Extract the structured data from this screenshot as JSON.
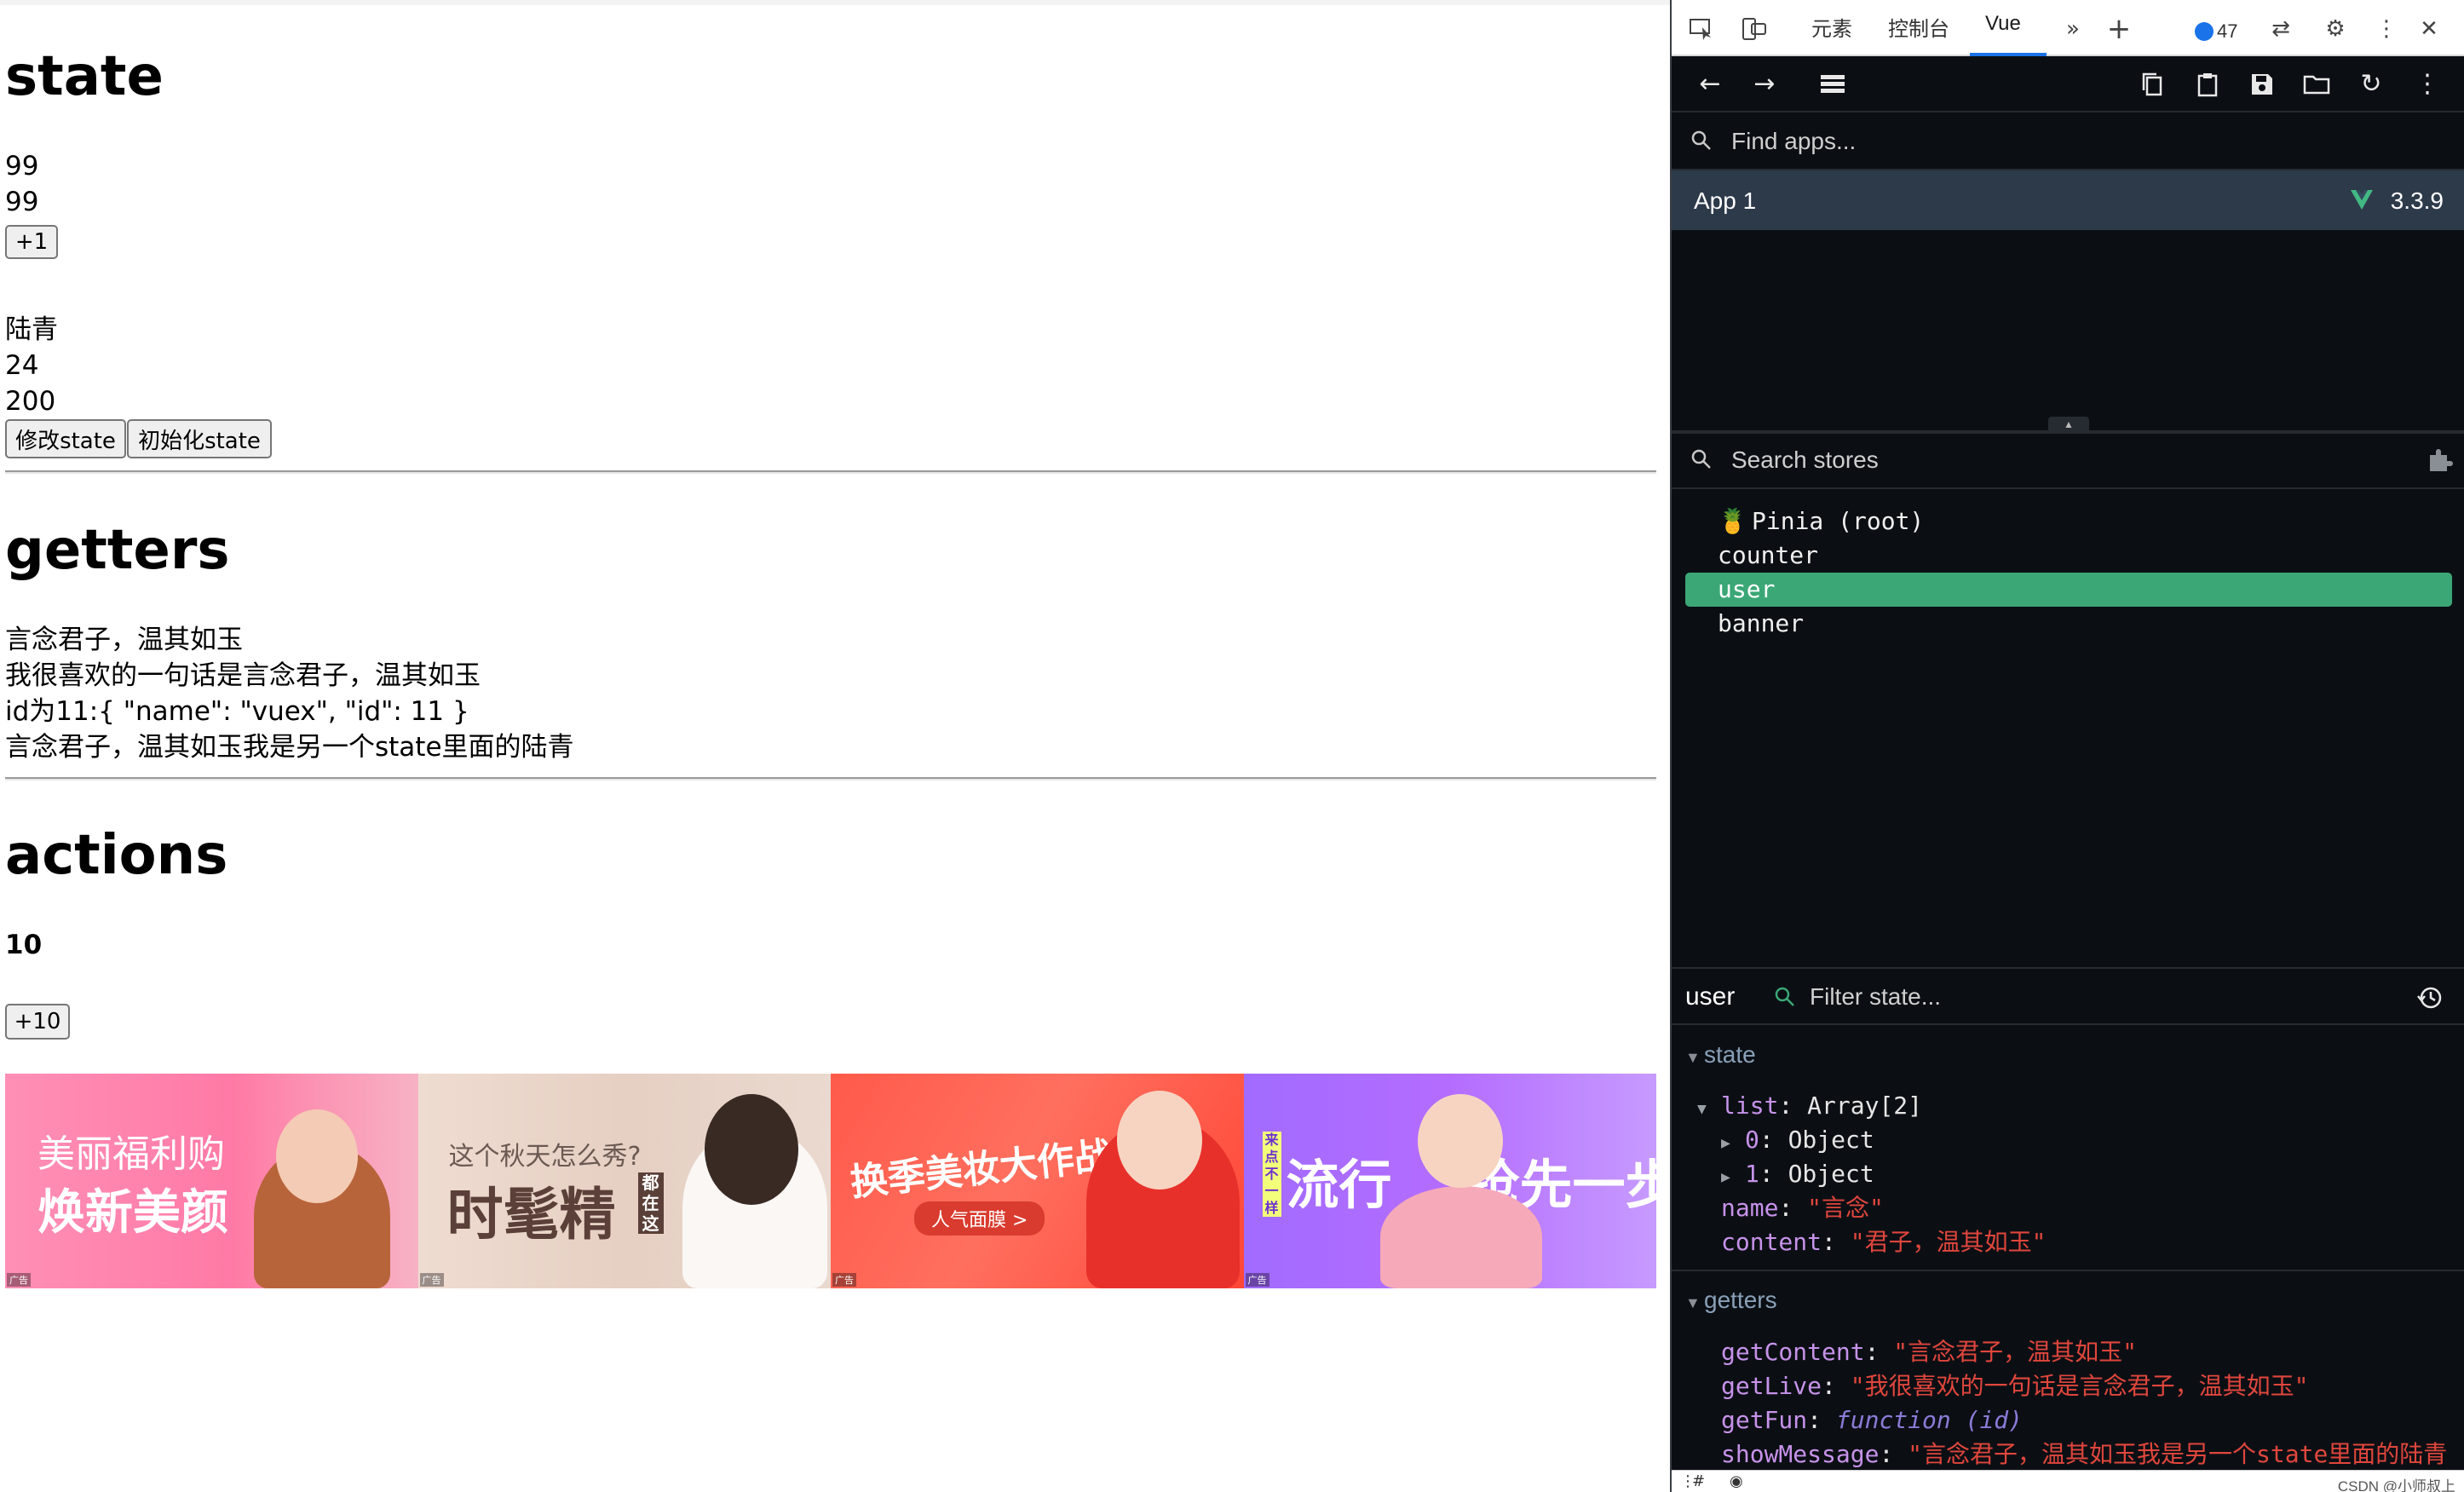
{
  "page": {
    "state_heading": "state",
    "state_values": [
      "99",
      "99"
    ],
    "plus_one_label": "+1",
    "user_name": "陆青",
    "user_age": "24",
    "user_score": "200",
    "modify_state_label": "修改state",
    "init_state_label": "初始化state",
    "getters_heading": "getters",
    "getter_lines": [
      "言念君子，温其如玉",
      "我很喜欢的一句话是言念君子，温其如玉",
      "id为11:{ \"name\": \"vuex\", \"id\": 11 }",
      "言念君子，温其如玉我是另一个state里面的陆青"
    ],
    "actions_heading": "actions",
    "actions_value": "10",
    "plus_ten_label": "+10",
    "banners": [
      {
        "line1": "美丽福利购",
        "line2": "焕新美颜",
        "ad": "广告"
      },
      {
        "line1": "这个秋天怎么秀?",
        "line2": "时髦精",
        "side": "都在这",
        "ad": "广告"
      },
      {
        "line1": "换季美妆大作战",
        "line2": "人气面膜 >",
        "ad": "广告"
      },
      {
        "line1": "流行",
        "line2": "抢先一步",
        "side": "来点不一样",
        "ad": "广告"
      }
    ]
  },
  "devtools": {
    "tabs": [
      "元素",
      "控制台",
      "Vue"
    ],
    "active_tab": "Vue",
    "issue_count": "47",
    "find_apps_placeholder": "Find apps...",
    "app_name": "App 1",
    "vue_version": "3.3.9",
    "search_stores_placeholder": "Search stores",
    "stores": [
      "Pinia (root)",
      "counter",
      "user",
      "banner"
    ],
    "selected_store": "user",
    "inspector_store": "user",
    "filter_state_placeholder": "Filter state...",
    "state_section": "state",
    "state_props": {
      "list_key": "list",
      "list_val": "Array[2]",
      "item0_key": "0",
      "item1_key": "1",
      "item_val": "Object",
      "name_key": "name",
      "name_val": "\"言念\"",
      "content_key": "content",
      "content_val": "\"君子，温其如玉\""
    },
    "getters_section": "getters",
    "getter_props": {
      "getContent_key": "getContent",
      "getContent_val": "\"言念君子，温其如玉\"",
      "getLive_key": "getLive",
      "getLive_val": "\"我很喜欢的一句话是言念君子，温其如玉\"",
      "getFun_key": "getFun",
      "getFun_val": "function (id)",
      "showMessage_key": "showMessage",
      "showMessage_val": "\"言念君子，温其如玉我是另一个state里面的陆青"
    },
    "watermark": "CSDN @小师叔上",
    "colors": {
      "panel_bg": "#0b0f14",
      "selected_store": "#3ba776",
      "app_row": "#2d3a4a",
      "string_value": "#e0463c",
      "key": "#c792ea",
      "vue_green": "#42b883"
    }
  }
}
